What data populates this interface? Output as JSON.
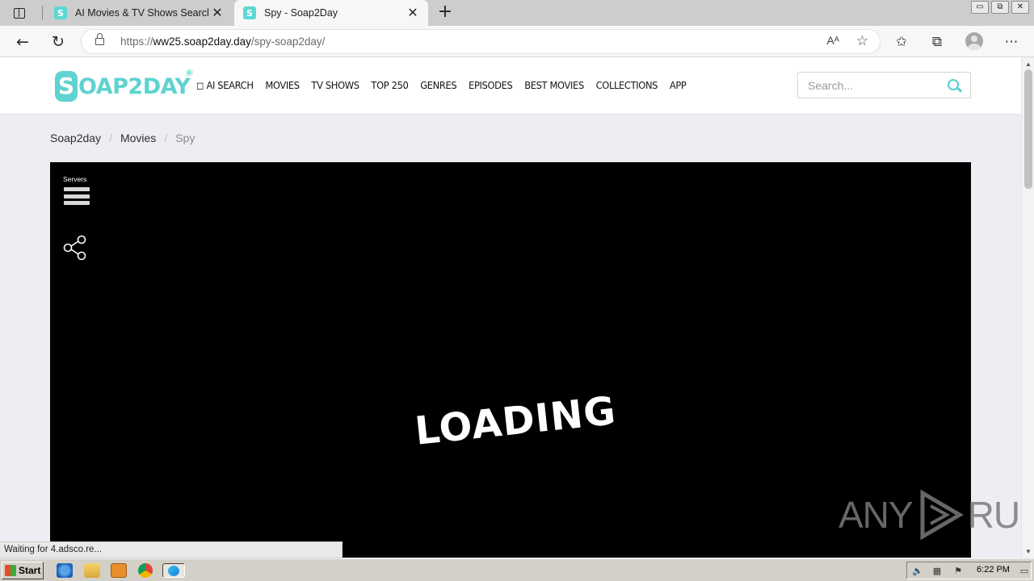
{
  "browser": {
    "tabs": [
      {
        "title": "AI Movies & TV Shows Search - ",
        "favicon": "S",
        "active": false
      },
      {
        "title": "Spy - Soap2Day",
        "favicon": "S",
        "active": true
      }
    ],
    "new_tab": "+",
    "close_glyph": "✕",
    "window_controls": [
      "▭",
      "⧉",
      "✕"
    ],
    "url_prefix": "https://",
    "url_host": "ww25.soap2day.day",
    "url_path": "/spy-soap2day/",
    "read_aloud": "Aᴬ",
    "status_text": "Waiting for 4.adsco.re..."
  },
  "site": {
    "logo_letter": "S",
    "logo_text": "OAP2DAY",
    "logo_accent": "#5fd3cf",
    "nav": [
      "◻ AI SEARCH",
      "MOVIES",
      "TV SHOWS",
      "TOP 250",
      "GENRES",
      "EPISODES",
      "BEST MOVIES",
      "COLLECTIONS",
      "APP"
    ],
    "search_placeholder": "Search..."
  },
  "breadcrumb": {
    "items": [
      "Soap2day",
      "Movies"
    ],
    "current": "Spy",
    "separator": "/"
  },
  "player": {
    "servers_label": "Servers",
    "loading_text": "LOADING",
    "watermark_left": "ANY",
    "watermark_right": "RUN"
  },
  "taskbar": {
    "start_label": "Start",
    "clock": "6:22 PM"
  }
}
